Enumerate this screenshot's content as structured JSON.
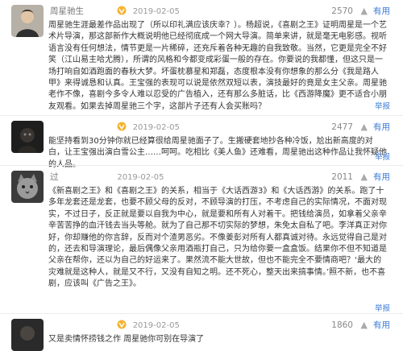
{
  "comments": [
    {
      "username": "周星驰生",
      "date": "2019-02-05",
      "likes": "2570",
      "useful_label": "有用",
      "report_label": "举报",
      "text": "周星驰生涯最差作品出现了（所以印礼满应该庆幸？）。杨超说，《喜剧之王》证明周星是一个艺术片导演，那这部新作大概说明他已经彻底成一个网大导演。简单来讲，就是毫无电影感。视听语言没有任何想法，情节更是一片稀碎，还充斥着各种无趣的自我致敬。当然，它更是完全不好笑（江山易主哈尤腾），所谓的风格和今都变成彩蛋一般的存在。你要说的我都懂，但这只是一场打响自如酒跑面的春秋大梦。坏蛋枕慕星和郑磊，态度根本没有你想象的那么分《我是路人甲》来得诚恳和认真。王宝强的表现可以说是依然双短以表，演技最好的竟是女主父亲。周星驰老作不像，喜剧今多令人难以忍受的广告植入，还有那么多脏话，比《西游降魔》更不适合小朋友观看。如果去掉周星驰三个字，这部片子还有人会买账吗？",
      "avatar": "avatar-man"
    },
    {
      "username": "",
      "date": "2019-02-05",
      "likes": "2477",
      "useful_label": "有用",
      "report_label": "举报",
      "text": "能坚持看到30分钟你就已经算很给周星驰面子了。生搬硬套地抄各种冷饭，尬出新高度的对白，让王宝强出演白雪公主……呵呵。吃相比《美人鱼》还难看，周星驰出这种作品让我怀疑他的人品。",
      "avatar": "avatar-dark"
    },
    {
      "username": "过",
      "date": "2019-02-05",
      "likes": "2011",
      "useful_label": "有用",
      "report_label": "举报",
      "text": "《新喜剧之王》和《喜剧之王》的关系，相当于《大话西游3》和《大话西游》的关系。跑了十多年龙套还是龙套，也要不顾父母的反对，不顾导演的打压，不考虑自己的实际情况，不面对现实，不过日子，反正就是要以自我为中心，就是要和所有人对着干。把钱给演员，如拿着父亲辛辛苦苦挣的血汗钱去当头等舱。就为了自己那不切实际的梦想，朱免太自私了吧。李洋真正对你好，你却赚他的你言辞，反而对个渣男恶劣。不像姜彭对所有人都真诚对待。永远觉得自己是对的，还去和导演理论，最后偶像父亲用酒瓶打自己，只为给你要一盒盒饭。结果你不但不知道是父亲在帮你，还以为自己的好运来了。果然流不能大世故，但也不能完全不要情商吧？‘最大的灾难就是这种人，就是又不行，又没有自知之明。还不死心，整天出来搞事情。’照不新，也不喜剧，应该叫《广告之王》。",
      "avatar": "avatar-cat"
    },
    {
      "username": "",
      "date": "2019-02-05",
      "likes": "1860",
      "useful_label": "有用",
      "report_label": "举报",
      "text": "又是卖情怀捞钱之作 周星驰你可别在导演了",
      "avatar": "avatar-dark"
    }
  ]
}
